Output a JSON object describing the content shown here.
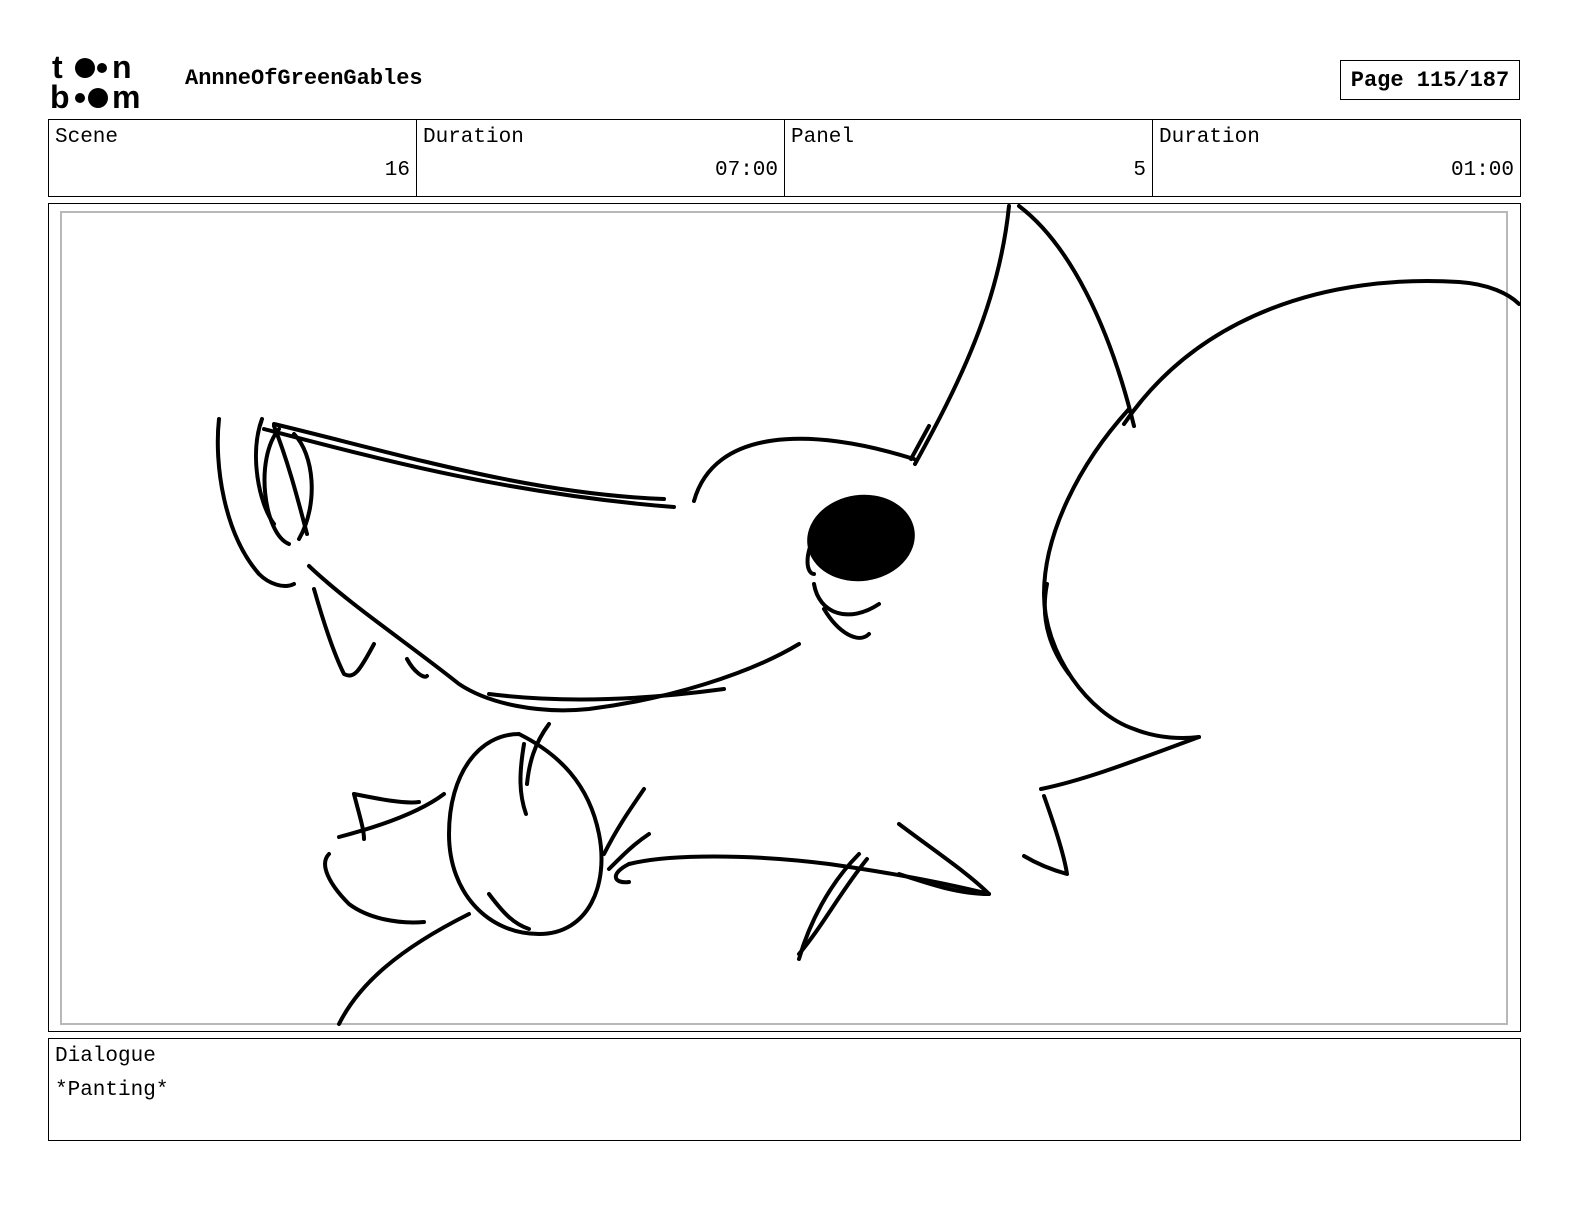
{
  "header": {
    "logo_text": "toonboom",
    "project_title": "AnnneOfGreenGables",
    "page_label": "Page 115/187"
  },
  "info": {
    "scene_label": "Scene",
    "scene_value": "16",
    "scene_duration_label": "Duration",
    "scene_duration_value": "07:00",
    "panel_label": "Panel",
    "panel_value": "5",
    "panel_duration_label": "Duration",
    "panel_duration_value": "01:00"
  },
  "dialogue": {
    "label": "Dialogue",
    "text": "*Panting*"
  }
}
